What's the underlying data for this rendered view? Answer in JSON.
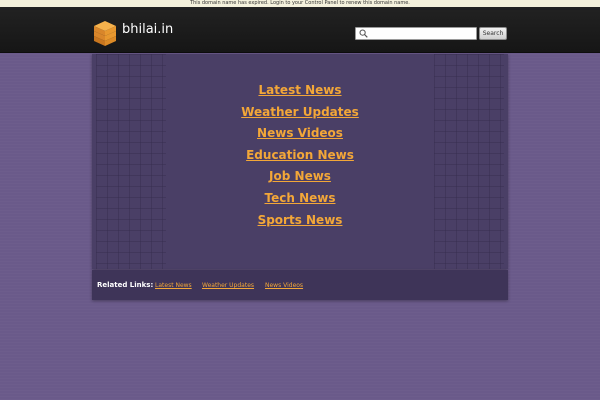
{
  "notice": {
    "text": "This domain name has expired. Login to your Control Panel to renew this domain name."
  },
  "header": {
    "site_name": "bhilai.in",
    "logo_icon": "stacked-boxes-icon",
    "search": {
      "placeholder": "",
      "value": "",
      "button_label": "Search"
    }
  },
  "main": {
    "links": [
      {
        "label": "Latest News"
      },
      {
        "label": "Weather Updates"
      },
      {
        "label": "News Videos"
      },
      {
        "label": "Education News"
      },
      {
        "label": "Job News"
      },
      {
        "label": "Tech News"
      },
      {
        "label": "Sports News"
      }
    ]
  },
  "related": {
    "label": "Related Links:",
    "links": [
      {
        "label": "Latest News"
      },
      {
        "label": "Weather Updates"
      },
      {
        "label": "News Videos"
      }
    ]
  },
  "colors": {
    "background": "#6a5a8a",
    "header": "#1c1c1c",
    "panel": "#4a3f66",
    "link": "#f3a738",
    "logo": "#f0a23a"
  }
}
